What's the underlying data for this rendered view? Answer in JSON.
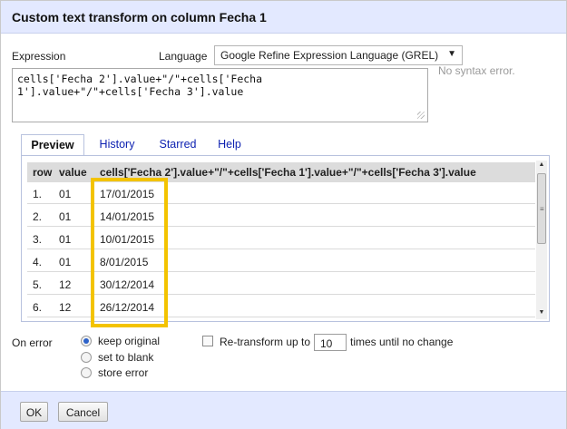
{
  "dialog": {
    "title": "Custom text transform on column Fecha 1"
  },
  "expression": {
    "label": "Expression",
    "text": "cells['Fecha 2'].value+\"/\"+cells['Fecha\n1'].value+\"/\"+cells['Fecha 3'].value",
    "status": "No syntax error."
  },
  "language": {
    "label": "Language",
    "selected": "Google Refine Expression Language (GREL)"
  },
  "tabs": [
    {
      "label": "Preview",
      "active": true
    },
    {
      "label": "History",
      "active": false
    },
    {
      "label": "Starred",
      "active": false
    },
    {
      "label": "Help",
      "active": false
    }
  ],
  "preview": {
    "columns": [
      "row",
      "value",
      "cells['Fecha 2'].value+\"/\"+cells['Fecha 1'].value+\"/\"+cells['Fecha 3'].value"
    ],
    "rows": [
      {
        "row": "1.",
        "value": "01",
        "result": "17/01/2015"
      },
      {
        "row": "2.",
        "value": "01",
        "result": "14/01/2015"
      },
      {
        "row": "3.",
        "value": "01",
        "result": "10/01/2015"
      },
      {
        "row": "4.",
        "value": "01",
        "result": "8/01/2015"
      },
      {
        "row": "5.",
        "value": "12",
        "result": "30/12/2014"
      },
      {
        "row": "6.",
        "value": "12",
        "result": "26/12/2014"
      }
    ],
    "highlight_color": "#f3c300"
  },
  "on_error": {
    "label": "On error",
    "options": [
      "keep original",
      "set to blank",
      "store error"
    ],
    "selected": "keep original"
  },
  "retransform": {
    "checked": false,
    "prefix": "Re-transform up to",
    "value": "10",
    "suffix": "times until no change"
  },
  "buttons": {
    "ok": "OK",
    "cancel": "Cancel"
  },
  "colors": {
    "header_bg": "#e3e9ff",
    "link": "#0b1fb0",
    "accent_radio": "#2d62c9"
  }
}
